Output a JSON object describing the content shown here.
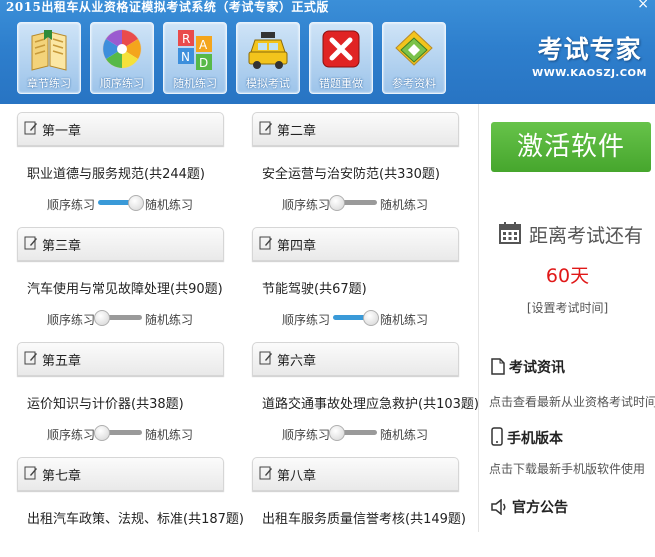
{
  "window": {
    "title": "2015出租车从业资格证模拟考试系统（考试专家）正式版",
    "close_label": "×"
  },
  "toolbar": {
    "items": [
      {
        "label": "章节练习",
        "icon": "book-icon"
      },
      {
        "label": "顺序练习",
        "icon": "color-wheel-icon"
      },
      {
        "label": "随机练习",
        "icon": "random-blocks-icon"
      },
      {
        "label": "模拟考试",
        "icon": "taxi-icon"
      },
      {
        "label": "错题重做",
        "icon": "error-x-icon"
      },
      {
        "label": "参考资料",
        "icon": "reference-icon"
      }
    ]
  },
  "brand": {
    "name": "考试专家",
    "url": "WWW.KAOSZJ.COM"
  },
  "chapters": [
    {
      "chapter": "第一章",
      "name": "职业道德与服务规范(共244题)",
      "left": "顺序练习",
      "right": "随机练习",
      "random_mode": true
    },
    {
      "chapter": "第二章",
      "name": "安全运营与治安防范(共330题)",
      "left": "顺序练习",
      "right": "随机练习",
      "random_mode": false
    },
    {
      "chapter": "第三章",
      "name": "汽车使用与常见故障处理(共90题)",
      "left": "顺序练习",
      "right": "随机练习",
      "random_mode": false
    },
    {
      "chapter": "第四章",
      "name": "节能驾驶(共67题)",
      "left": "顺序练习",
      "right": "随机练习",
      "random_mode": true
    },
    {
      "chapter": "第五章",
      "name": "运价知识与计价器(共38题)",
      "left": "顺序练习",
      "right": "随机练习",
      "random_mode": false
    },
    {
      "chapter": "第六章",
      "name": "道路交通事故处理应急救护(共103题)",
      "left": "顺序练习",
      "right": "随机练习",
      "random_mode": false
    },
    {
      "chapter": "第七章",
      "name": "出租汽车政策、法规、标准(共187题)",
      "left": "顺序练习",
      "right": "随机练习",
      "random_mode": false
    },
    {
      "chapter": "第八章",
      "name": "出租车服务质量信誉考核(共149题)",
      "left": "顺序练习",
      "right": "随机练习",
      "random_mode": false
    }
  ],
  "side": {
    "activate_label": "激活软件",
    "countdown_label": "距离考试还有",
    "days": "60天",
    "set_exam_time": "[设置考试时间]",
    "news_title": "考试资讯",
    "news_desc": "点击查看最新从业资格考试时间",
    "mobile_title": "手机版本",
    "mobile_desc": "点击下载最新手机版软件使用",
    "notice_title": "官方公告"
  },
  "colors": {
    "header_blue": "#2e7fcd",
    "activate_green": "#4fb034",
    "countdown_red": "#e01818",
    "toggle_on": "#3a9ad8"
  }
}
